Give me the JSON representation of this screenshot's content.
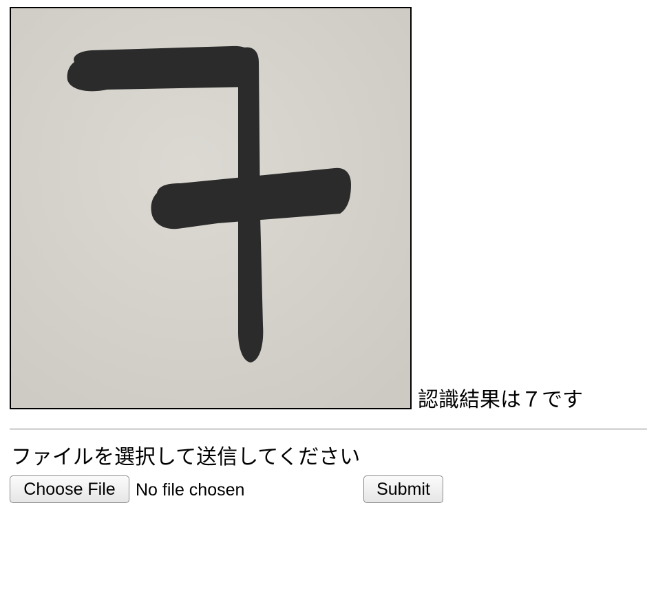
{
  "result": {
    "image_content": "handwritten digit 7 in black brush ink on paper",
    "text": "認識結果は７です"
  },
  "instruction": "ファイルを選択して送信してください",
  "form": {
    "choose_file_label": "Choose File",
    "file_status": "No file chosen",
    "submit_label": "Submit"
  },
  "colors": {
    "paper": "#d6d3cd",
    "ink": "#2b2b2b",
    "border": "#000000",
    "divider": "#9a9a9a"
  }
}
